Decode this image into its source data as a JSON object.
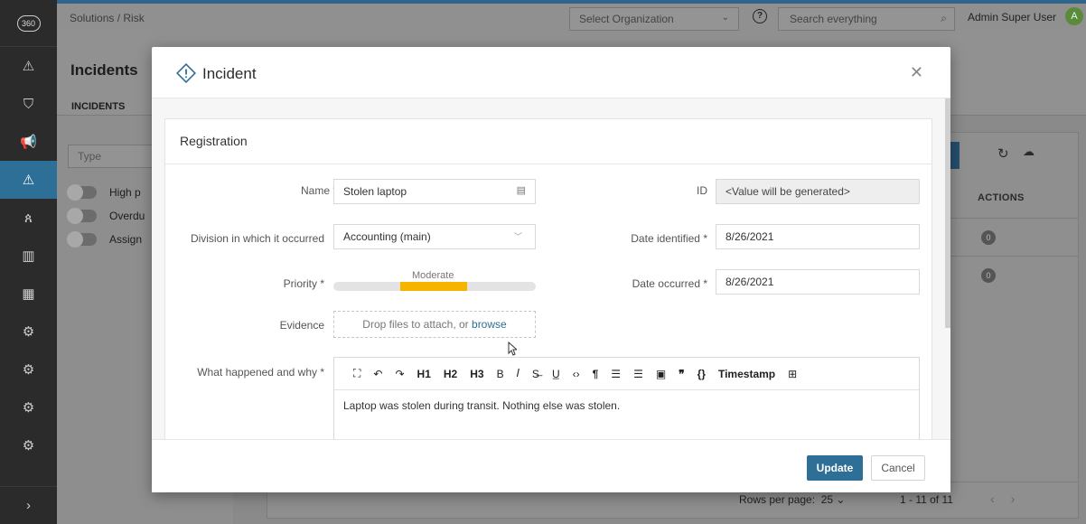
{
  "nav": {
    "logo_text": "360",
    "items": [
      {
        "icon": "warning-icon"
      },
      {
        "icon": "tag-icon"
      },
      {
        "icon": "megaphone-icon"
      },
      {
        "icon": "warning-icon",
        "active": true
      },
      {
        "icon": "users-icon"
      },
      {
        "icon": "library-icon"
      },
      {
        "icon": "building-icon"
      },
      {
        "icon": "gear-icon"
      },
      {
        "icon": "gear-icon"
      },
      {
        "icon": "gear-icon"
      },
      {
        "icon": "gear-icon"
      }
    ],
    "expand_icon": "chevron-right-icon"
  },
  "topbar": {
    "breadcrumb": "Solutions / Risk",
    "org_select": "Select Organization",
    "search_placeholder": "Search everything",
    "user_name": "Admin Super User",
    "user_initial": "A"
  },
  "page": {
    "title": "Incidents",
    "tab": "INCIDENTS",
    "type_placeholder": "Type",
    "toggles": [
      "High p",
      "Overdu",
      "Assign"
    ],
    "actions_header": "ACTIONS",
    "row_badges": [
      "0",
      "0"
    ],
    "pager": {
      "rows_per_page_label": "Rows per page:",
      "rows_per_page_value": "25",
      "range": "1 - 11 of 11"
    }
  },
  "modal": {
    "title": "Incident",
    "section_title": "Registration",
    "name_label": "Name *",
    "name_value": "Stolen laptop",
    "id_label": "ID",
    "id_value": "<Value will be generated>",
    "division_label": "Division in which it occurred",
    "division_value": "Accounting (main)",
    "date_identified_label": "Date identified *",
    "date_identified_value": "8/26/2021",
    "priority_label": "Priority *",
    "priority_value": "Moderate",
    "priority_level": {
      "start": 0.33,
      "end": 0.66
    },
    "date_occurred_label": "Date occurred *",
    "date_occurred_value": "8/26/2021",
    "evidence_label": "Evidence",
    "evidence_text": "Drop files to attach, or",
    "evidence_link": "browse",
    "what_label": "What happened and why *",
    "toolbar": [
      {
        "name": "fullscreen-icon",
        "text": "⛶",
        "norm": true
      },
      {
        "name": "undo-icon",
        "text": "↶",
        "norm": true
      },
      {
        "name": "redo-icon",
        "text": "↷",
        "norm": true
      },
      {
        "name": "heading1-button",
        "text": "H1"
      },
      {
        "name": "heading2-button",
        "text": "H2"
      },
      {
        "name": "heading3-button",
        "text": "H3"
      },
      {
        "name": "bold-button",
        "text": "B",
        "norm": true
      },
      {
        "name": "italic-button",
        "text": "𝐼",
        "norm": true
      },
      {
        "name": "strikethrough-button",
        "text": "S̶",
        "norm": true
      },
      {
        "name": "underline-button",
        "text": "U̲",
        "norm": true
      },
      {
        "name": "code-icon",
        "text": "‹›",
        "norm": true
      },
      {
        "name": "paragraph-icon",
        "text": "¶"
      },
      {
        "name": "bullet-list-icon",
        "text": "☰",
        "norm": true
      },
      {
        "name": "numbered-list-icon",
        "text": "☰",
        "norm": true
      },
      {
        "name": "image-icon",
        "text": "▣",
        "norm": true
      },
      {
        "name": "quote-icon",
        "text": "❞"
      },
      {
        "name": "code-block-icon",
        "text": "{}"
      },
      {
        "name": "timestamp-button",
        "text": "Timestamp"
      },
      {
        "name": "table-icon",
        "text": "⊞",
        "norm": true
      }
    ],
    "editor_text": "Laptop was stolen during transit. Nothing else was stolen.",
    "update_label": "Update",
    "cancel_label": "Cancel"
  },
  "colors": {
    "accent": "#2d6f96",
    "priority": "#f4b400",
    "nav_bg": "#2b2b2b"
  }
}
